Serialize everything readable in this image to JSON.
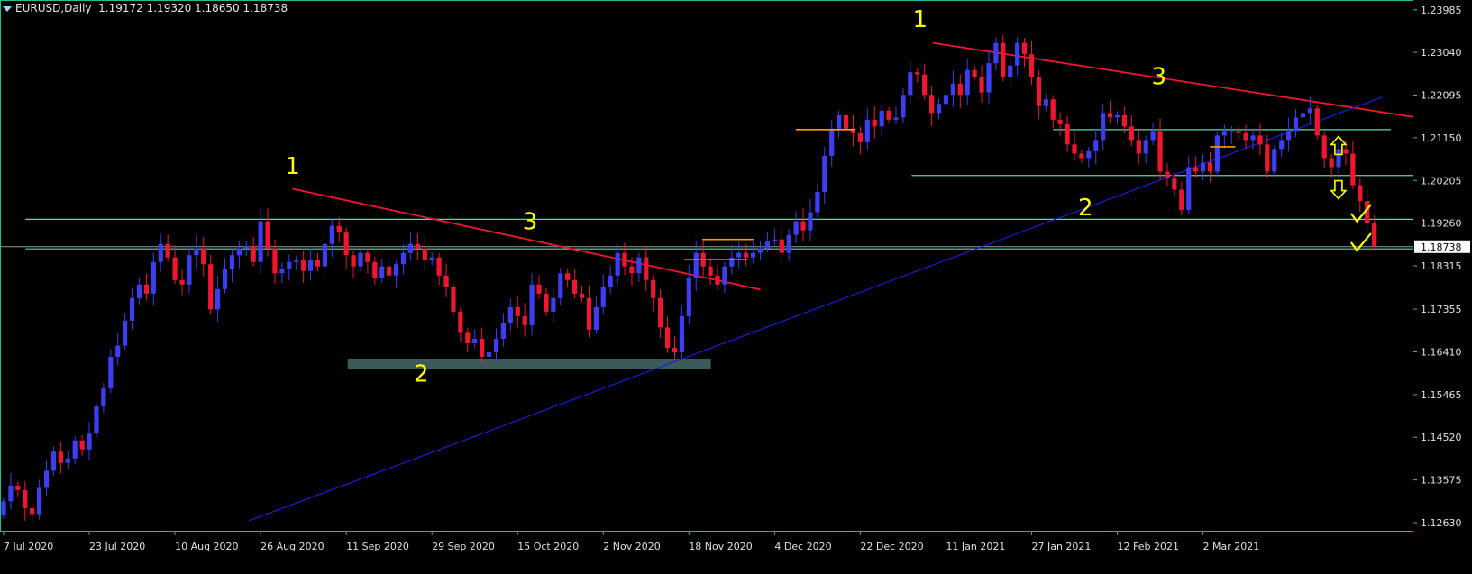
{
  "header": {
    "symbol": "EURUSD,Daily",
    "ohlc": "1.19172 1.19320 1.18650 1.18738"
  },
  "colors": {
    "background": "#000000",
    "frame": "#1fbf93",
    "axis_text": "#e0e0e0",
    "bull": "#3d3df2",
    "bear": "#f0162f",
    "support_hline": "#53dca6",
    "trend_red": "#f0162f",
    "trend_blue": "#1c1cdc",
    "zone": "#3b5a5a",
    "wave_labels": "#ffff00",
    "orange_lines": "#ff9a00",
    "price_tag_bg": "#ffffff",
    "price_tag_text": "#000000"
  },
  "chart_data": {
    "type": "candlestick",
    "symbol": "EURUSD",
    "timeframe": "Daily",
    "current_price": "1.18738",
    "y_ticks": [
      "1.23985",
      "1.23040",
      "1.22095",
      "1.21150",
      "1.20205",
      "1.19260",
      "1.18315",
      "1.17355",
      "1.16410",
      "1.15465",
      "1.14520",
      "1.13575",
      "1.12630"
    ],
    "ylim": [
      1.1243,
      1.2412
    ],
    "x_ticks": [
      "7 Jul 2020",
      "23 Jul 2020",
      "10 Aug 2020",
      "26 Aug 2020",
      "11 Sep 2020",
      "29 Sep 2020",
      "15 Oct 2020",
      "2 Nov 2020",
      "18 Nov 2020",
      "4 Dec 2020",
      "22 Dec 2020",
      "11 Jan 2021",
      "27 Jan 2021",
      "12 Feb 2021",
      "2 Mar 2021"
    ],
    "bars_per_tick": 12,
    "closes": [
      1.131,
      1.1345,
      1.1335,
      1.1295,
      1.1282,
      1.134,
      1.1378,
      1.142,
      1.1395,
      1.1405,
      1.1445,
      1.1425,
      1.146,
      1.152,
      1.156,
      1.163,
      1.1655,
      1.171,
      1.176,
      1.179,
      1.177,
      1.184,
      1.188,
      1.185,
      1.18,
      1.179,
      1.1855,
      1.187,
      1.1835,
      1.1735,
      1.178,
      1.1825,
      1.1855,
      1.187,
      1.1875,
      1.184,
      1.193,
      1.187,
      1.1815,
      1.1825,
      1.184,
      1.1845,
      1.182,
      1.1845,
      1.183,
      1.188,
      1.192,
      1.1905,
      1.1855,
      1.183,
      1.186,
      1.184,
      1.1805,
      1.183,
      1.181,
      1.1835,
      1.186,
      1.188,
      1.187,
      1.1845,
      1.185,
      1.181,
      1.1785,
      1.173,
      1.1685,
      1.166,
      1.167,
      1.163,
      1.164,
      1.167,
      1.1705,
      1.174,
      1.172,
      1.17,
      1.179,
      1.177,
      1.173,
      1.176,
      1.1815,
      1.18,
      1.177,
      1.176,
      1.169,
      1.174,
      1.1785,
      1.181,
      1.186,
      1.183,
      1.1815,
      1.185,
      1.18,
      1.176,
      1.1695,
      1.165,
      1.164,
      1.172,
      1.1805,
      1.186,
      1.183,
      1.181,
      1.179,
      1.183,
      1.185,
      1.186,
      1.185,
      1.186,
      1.187,
      1.1885,
      1.189,
      1.186,
      1.19,
      1.193,
      1.191,
      1.195,
      1.1995,
      1.2075,
      1.2135,
      1.2165,
      1.2135,
      1.2125,
      1.2105,
      1.2155,
      1.214,
      1.2175,
      1.2155,
      1.216,
      1.221,
      1.226,
      1.2255,
      1.221,
      1.217,
      1.219,
      1.221,
      1.2235,
      1.221,
      1.2265,
      1.225,
      1.2215,
      1.228,
      1.2325,
      1.225,
      1.2275,
      1.2325,
      1.23,
      1.225,
      1.2185,
      1.22,
      1.2155,
      1.2145,
      1.21,
      1.208,
      1.207,
      1.2085,
      1.211,
      1.217,
      1.216,
      1.2165,
      1.214,
      1.211,
      1.208,
      1.211,
      1.213,
      1.204,
      1.2025,
      1.2,
      1.1955,
      1.205,
      1.204,
      1.206,
      1.204,
      1.212,
      1.213,
      1.213,
      1.2125,
      1.211,
      1.212,
      1.21,
      1.204,
      1.209,
      1.211,
      1.213,
      1.216,
      1.217,
      1.218,
      1.212,
      1.207,
      1.205,
      1.209,
      1.208,
      1.201,
      1.1975,
      1.1925,
      1.1874
    ],
    "horizontal_lines": [
      {
        "price": 1.19345,
        "x_start": 0.018,
        "x_end": 1.0
      },
      {
        "price": 1.1869,
        "x_start": 0.018,
        "x_end": 1.0
      },
      {
        "price": 1.20315,
        "x_start": 0.645,
        "x_end": 1.0
      },
      {
        "price": 1.2133,
        "x_start": 0.745,
        "x_end": 0.984
      }
    ],
    "support_zone": {
      "price_high": 1.1626,
      "price_low": 1.1604,
      "x_start": 0.246,
      "x_end": 0.503
    },
    "trendlines": [
      {
        "color": "red",
        "from": {
          "x": 0.207,
          "price": 1.2002
        },
        "to": {
          "x": 0.538,
          "price": 1.1779
        }
      },
      {
        "color": "red",
        "from": {
          "x": 0.66,
          "price": 1.2325
        },
        "to": {
          "x": 1.0,
          "price": 1.2161
        }
      },
      {
        "color": "blue",
        "from": {
          "x": 0.176,
          "price": 1.1267
        },
        "to": {
          "x": 0.978,
          "price": 1.2205
        }
      }
    ],
    "orange_markers": [
      {
        "price": 1.2133,
        "x_start": 0.563,
        "x_end": 0.605
      },
      {
        "price": 1.189,
        "x_start": 0.497,
        "x_end": 0.533
      },
      {
        "price": 1.1845,
        "x_start": 0.484,
        "x_end": 0.529
      },
      {
        "price": 1.2095,
        "x_start": 0.856,
        "x_end": 0.874
      }
    ],
    "annotations": [
      {
        "text": "1",
        "x": 0.207,
        "price": 1.2035
      },
      {
        "text": "2",
        "x": 0.298,
        "price": 1.1575
      },
      {
        "text": "3",
        "x": 0.375,
        "price": 1.1912
      },
      {
        "text": "1",
        "x": 0.651,
        "price": 1.236
      },
      {
        "text": "2",
        "x": 0.768,
        "price": 1.1943
      },
      {
        "text": "3",
        "x": 0.82,
        "price": 1.2233
      }
    ],
    "arrows": [
      {
        "direction": "up",
        "x": 0.947,
        "price": 1.2096
      },
      {
        "direction": "down",
        "x": 0.947,
        "price": 1.2002
      }
    ],
    "checkmarks": [
      {
        "x": 0.962,
        "price": 1.1942
      },
      {
        "x": 0.962,
        "price": 1.1878
      }
    ]
  }
}
